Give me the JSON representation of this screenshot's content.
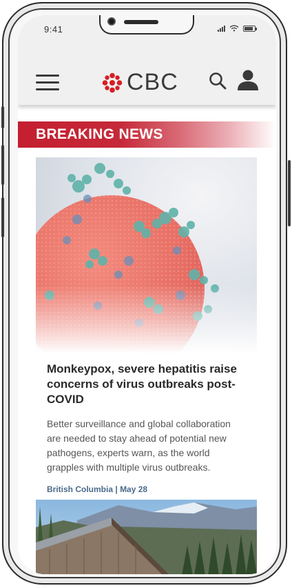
{
  "status_bar": {
    "time": "9:41"
  },
  "header": {
    "logo_text": "CBC",
    "menu_icon": "hamburger-menu-icon",
    "search_icon": "search-icon",
    "account_icon": "user-account-icon"
  },
  "breaking_banner": {
    "label": "BREAKING NEWS"
  },
  "articles": [
    {
      "headline": "Monkeypox, severe hepatitis raise concerns of virus outbreaks post-COVID",
      "summary": "Better surveillance and global collaboration are needed to stay ahead of potential new pathogens, experts warn, as the world grapples with multiple virus outbreaks.",
      "region": "British Columbia",
      "separator": "|",
      "date": "May 28"
    },
    {
      "headline": "",
      "summary": ""
    }
  ],
  "colors": {
    "brand_red": "#c41f2f",
    "meta_blue": "#4a6a8a",
    "header_bg": "#f0f0f0"
  }
}
